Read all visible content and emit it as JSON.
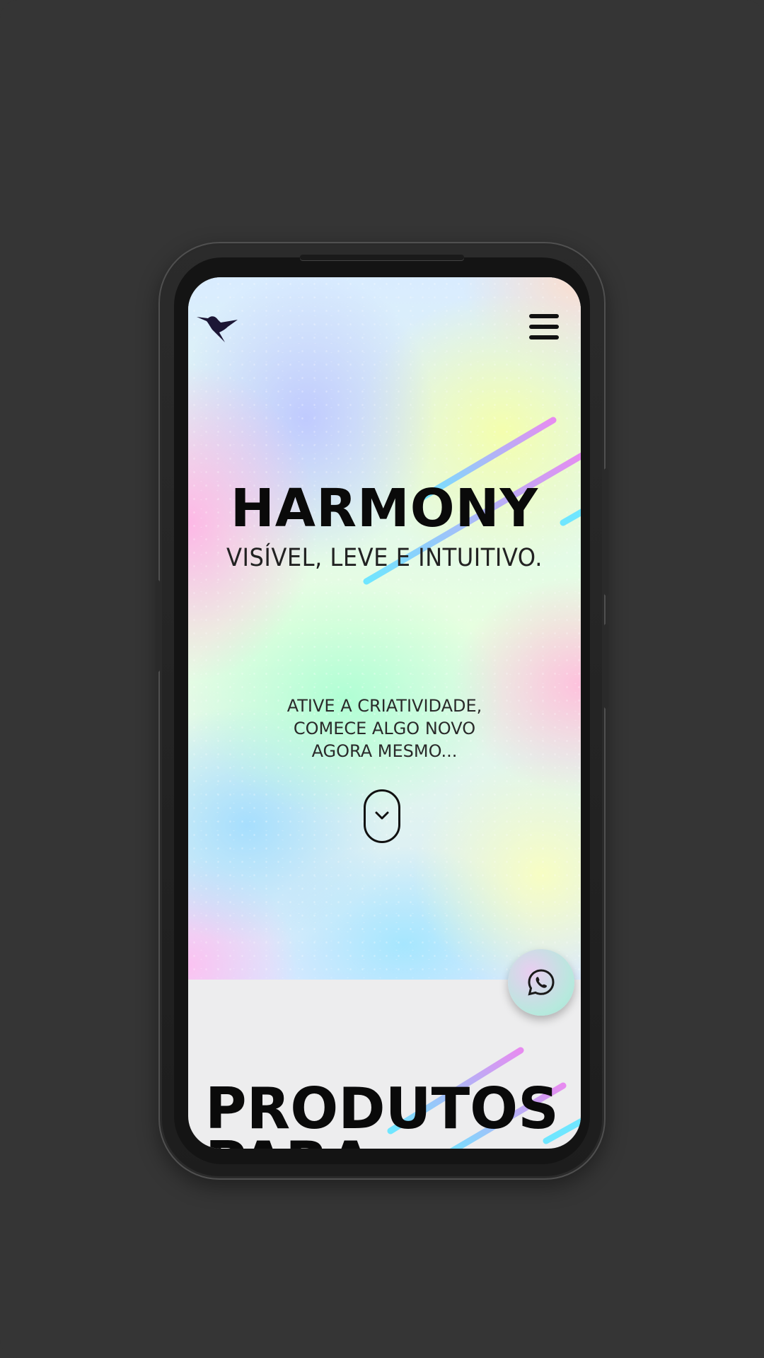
{
  "hero": {
    "title": "HARMONY",
    "subtitle": "VISÍVEL, LEVE E INTUITIVO.",
    "tagline": [
      "ATIVE A CRIATIVIDADE,",
      "COMECE ALGO NOVO",
      "AGORA MESMO..."
    ]
  },
  "section": {
    "title_line1": "PRODUTOS",
    "title_line2": "PARA"
  },
  "icons": {
    "logo": "hummingbird-icon",
    "menu": "hamburger-menu-icon",
    "scroll": "chevron-down-icon",
    "chat": "whatsapp-icon"
  },
  "colors": {
    "page_background": "#353535",
    "text_primary": "#0a0a0a",
    "stripe_pink": "#e78bf0",
    "stripe_cyan": "#6fe6ff"
  }
}
